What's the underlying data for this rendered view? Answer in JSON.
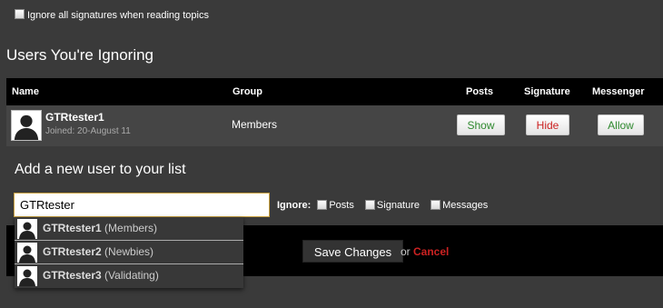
{
  "options": {
    "ignore_signatures_label": "Ignore all signatures when reading topics"
  },
  "section_title": "Users You're Ignoring",
  "table": {
    "headers": {
      "name": "Name",
      "group": "Group",
      "posts": "Posts",
      "signature": "Signature",
      "messenger": "Messenger"
    },
    "row": {
      "username": "GTRtester1",
      "joined": "Joined: 20-August 11",
      "group": "Members",
      "posts_button": "Show",
      "signature_button": "Hide",
      "messenger_button": "Allow"
    }
  },
  "add_user": {
    "title": "Add a new user to your list",
    "input_value": "GTRtester",
    "ignore_label": "Ignore:",
    "options": {
      "posts": "Posts",
      "signature": "Signature",
      "messages": "Messages"
    }
  },
  "autocomplete": [
    {
      "name": "GTRtester1",
      "group": "(Members)"
    },
    {
      "name": "GTRtester2",
      "group": "(Newbies)"
    },
    {
      "name": "GTRtester3",
      "group": "(Validating)"
    }
  ],
  "actions": {
    "save_label": "Save Changes",
    "or_text": "or",
    "cancel_label": "Cancel"
  },
  "colors": {
    "show_allow": "#2f8a2f",
    "hide_cancel": "#cc2222",
    "input_border": "#c8a040"
  }
}
